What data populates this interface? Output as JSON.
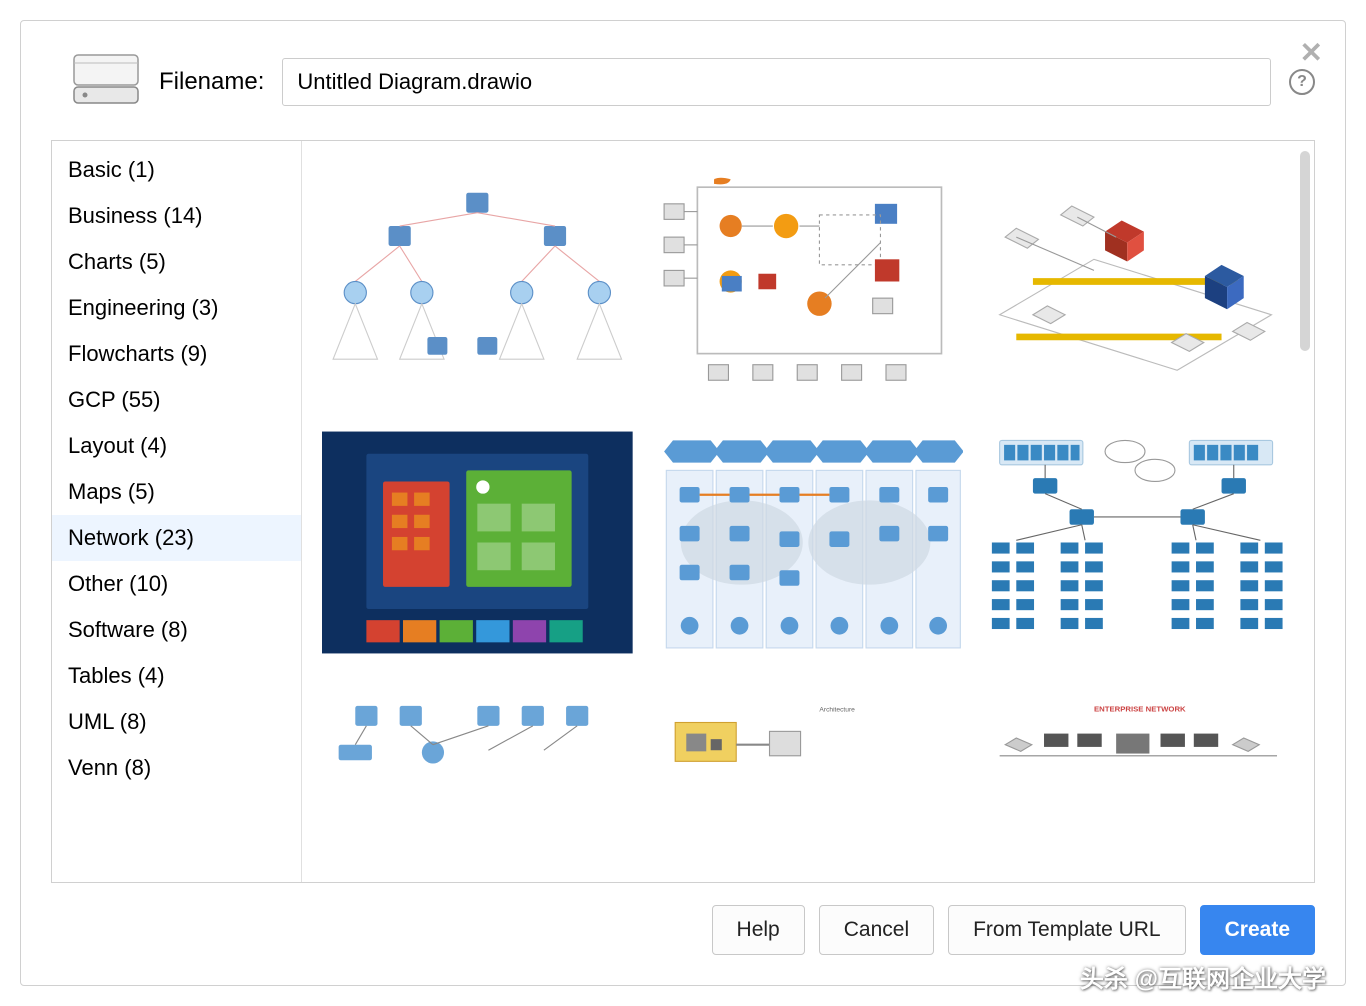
{
  "dialog": {
    "filename_label": "Filename:",
    "filename_value": "Untitled Diagram.drawio",
    "help_icon_glyph": "?"
  },
  "sidebar": {
    "items": [
      {
        "label": "Basic (1)",
        "name": "basic"
      },
      {
        "label": "Business (14)",
        "name": "business"
      },
      {
        "label": "Charts (5)",
        "name": "charts"
      },
      {
        "label": "Engineering (3)",
        "name": "engineering"
      },
      {
        "label": "Flowcharts (9)",
        "name": "flowcharts"
      },
      {
        "label": "GCP (55)",
        "name": "gcp"
      },
      {
        "label": "Layout (4)",
        "name": "layout"
      },
      {
        "label": "Maps (5)",
        "name": "maps"
      },
      {
        "label": "Network (23)",
        "name": "network",
        "selected": true
      },
      {
        "label": "Other (10)",
        "name": "other"
      },
      {
        "label": "Software (8)",
        "name": "software"
      },
      {
        "label": "Tables (4)",
        "name": "tables"
      },
      {
        "label": "UML (8)",
        "name": "uml"
      },
      {
        "label": "Venn (8)",
        "name": "venn"
      }
    ]
  },
  "templates": [
    {
      "name": "network-topology-servers"
    },
    {
      "name": "network-aws-architecture"
    },
    {
      "name": "network-isometric-topology"
    },
    {
      "name": "network-dashboard-blue"
    },
    {
      "name": "network-cloud-columns"
    },
    {
      "name": "network-tree-cisco"
    },
    {
      "name": "network-lan-group"
    },
    {
      "name": "network-simple-connection"
    },
    {
      "name": "network-enterprise"
    }
  ],
  "footer": {
    "help": "Help",
    "cancel": "Cancel",
    "from_template_url": "From Template URL",
    "create": "Create"
  },
  "watermark": "头杀 @互联网企业大学"
}
